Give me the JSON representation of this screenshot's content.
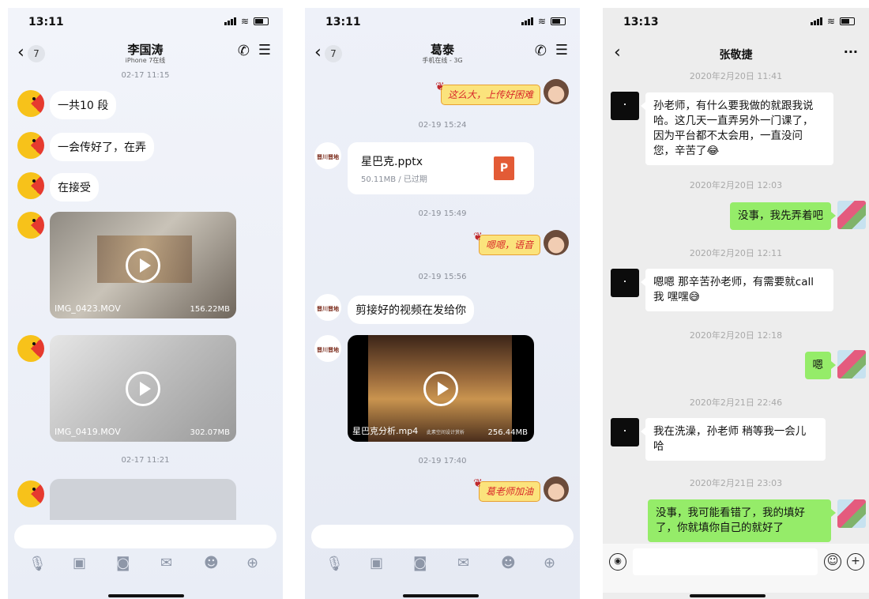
{
  "status": {
    "time_a": "13:11",
    "time_b": "13:11",
    "time_c": "13:13"
  },
  "chat1": {
    "back_count": "7",
    "title": "李国涛",
    "subtitle": "iPhone 7在线",
    "timestamps": [
      "02-17 11:15",
      "02-17 11:21"
    ],
    "messages": [
      "一共10 段",
      "一会传好了，在弄",
      "在接受"
    ],
    "videos": [
      {
        "name": "IMG_0423.MOV",
        "size": "156.22MB"
      },
      {
        "name": "IMG_0419.MOV",
        "size": "302.07MB"
      }
    ],
    "toolbar_icons": [
      "mic-icon",
      "image-icon",
      "camera-icon",
      "red-packet-icon",
      "emoji-icon",
      "plus-icon"
    ]
  },
  "chat2": {
    "back_count": "7",
    "title": "葛泰",
    "subtitle": "手机在线 - 3G",
    "stickers": [
      "这么大，上传好困难",
      "嗯嗯，语音",
      "葛老师加油"
    ],
    "timestamps": [
      "02-19 15:24",
      "02-19 15:49",
      "02-19 15:56",
      "02-19 17:40"
    ],
    "file": {
      "name": "星巴克.pptx",
      "meta": "50.11MB / 已过期",
      "icon_label": "P"
    },
    "message": "剪接好的视频在发给你",
    "video": {
      "name": "星巴克分析.mp4",
      "caption": "此素空间设计赏析",
      "size": "256.44MB"
    },
    "avatar_text": "晋川晋地"
  },
  "chat3": {
    "title": "张敬捷",
    "more": "···",
    "timestamps": [
      "2020年2月20日 11:41",
      "2020年2月20日 12:03",
      "2020年2月20日 12:11",
      "2020年2月20日 12:18",
      "2020年2月21日 22:46",
      "2020年2月21日 23:03"
    ],
    "messages": {
      "m1_l1": "孙老师，有什么要我做的就跟我说",
      "m1_l2": "哈。这几天一直弄另外一门课了，",
      "m1_l3": "因为平台都不太会用，一直没问",
      "m1_l4": "您，辛苦了😂",
      "m2": "没事，我先弄着吧",
      "m3_l1": "嗯嗯 那辛苦孙老师，有需要就call",
      "m3_l2": "我 嘿嘿😅",
      "m4": "嗯",
      "m5_l1": "我在洗澡，孙老师 稍等我一会儿",
      "m5_l2": "哈",
      "m6_l1": "没事，我可能看错了，我的填好",
      "m6_l2": "了，你就填你自己的就好了"
    }
  }
}
